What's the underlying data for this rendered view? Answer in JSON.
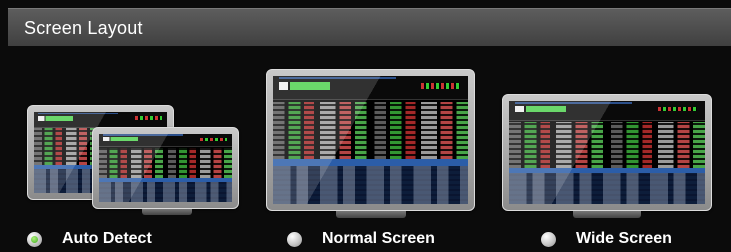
{
  "header": {
    "title": "Screen Layout"
  },
  "options": [
    {
      "label": "Auto Detect",
      "selected": true
    },
    {
      "label": "Normal Screen",
      "selected": false
    },
    {
      "label": "Wide Screen",
      "selected": false
    }
  ],
  "colors": {
    "accent_selected": "#3fae22",
    "header_bg": "#4d4d4d"
  }
}
